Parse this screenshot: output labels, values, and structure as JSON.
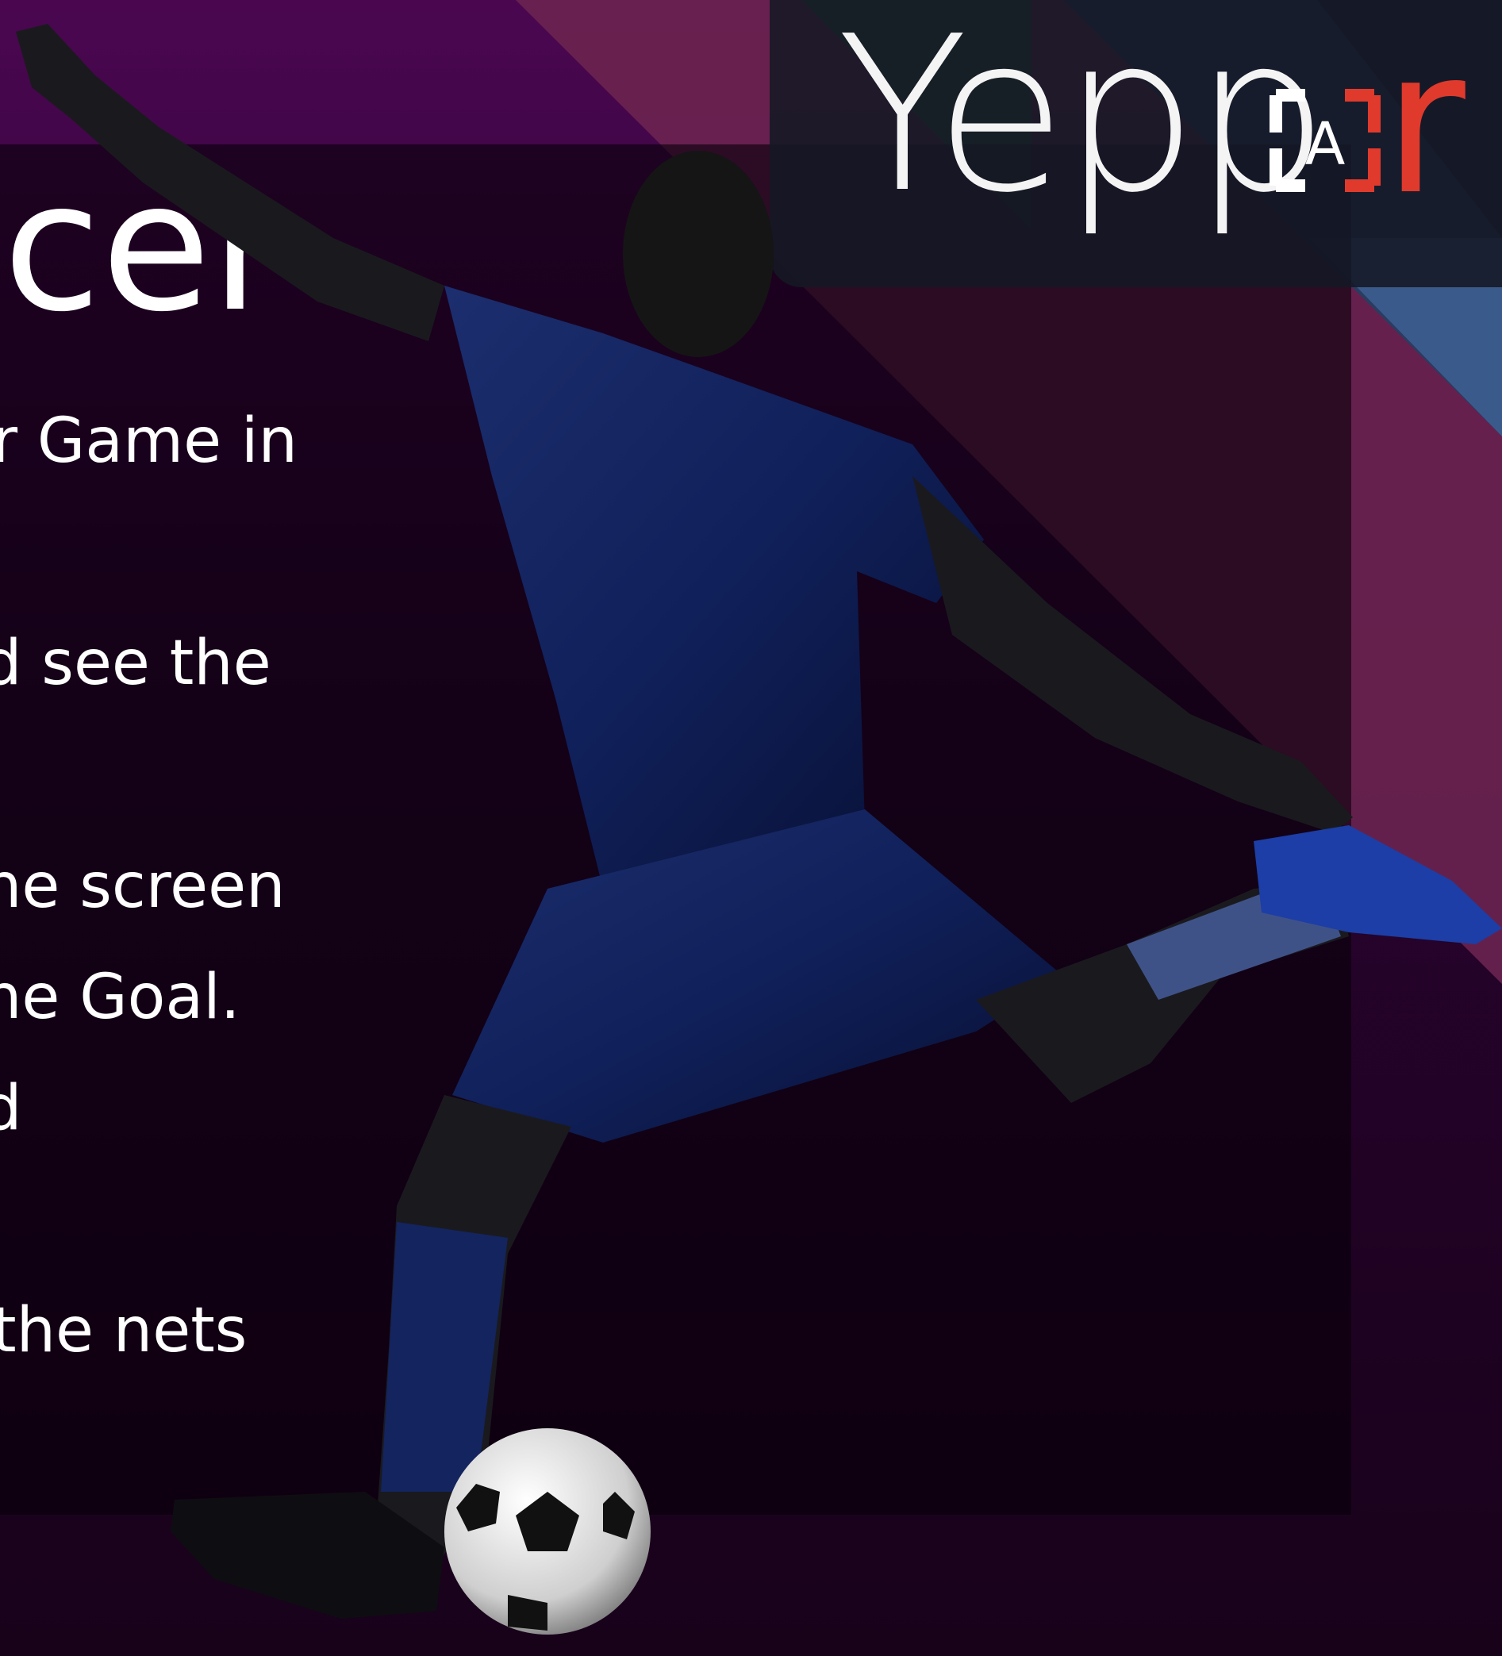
{
  "slide": {
    "title_fragment": "ccer",
    "lines": [
      "r Game in",
      "d see the",
      "ne screen",
      "ne Goal.",
      "d",
      " the nets"
    ]
  },
  "brand": {
    "logo_text": "Yepp",
    "logo_ar": "A",
    "logo_tail": "r",
    "accent_color": "#e03a2c"
  }
}
